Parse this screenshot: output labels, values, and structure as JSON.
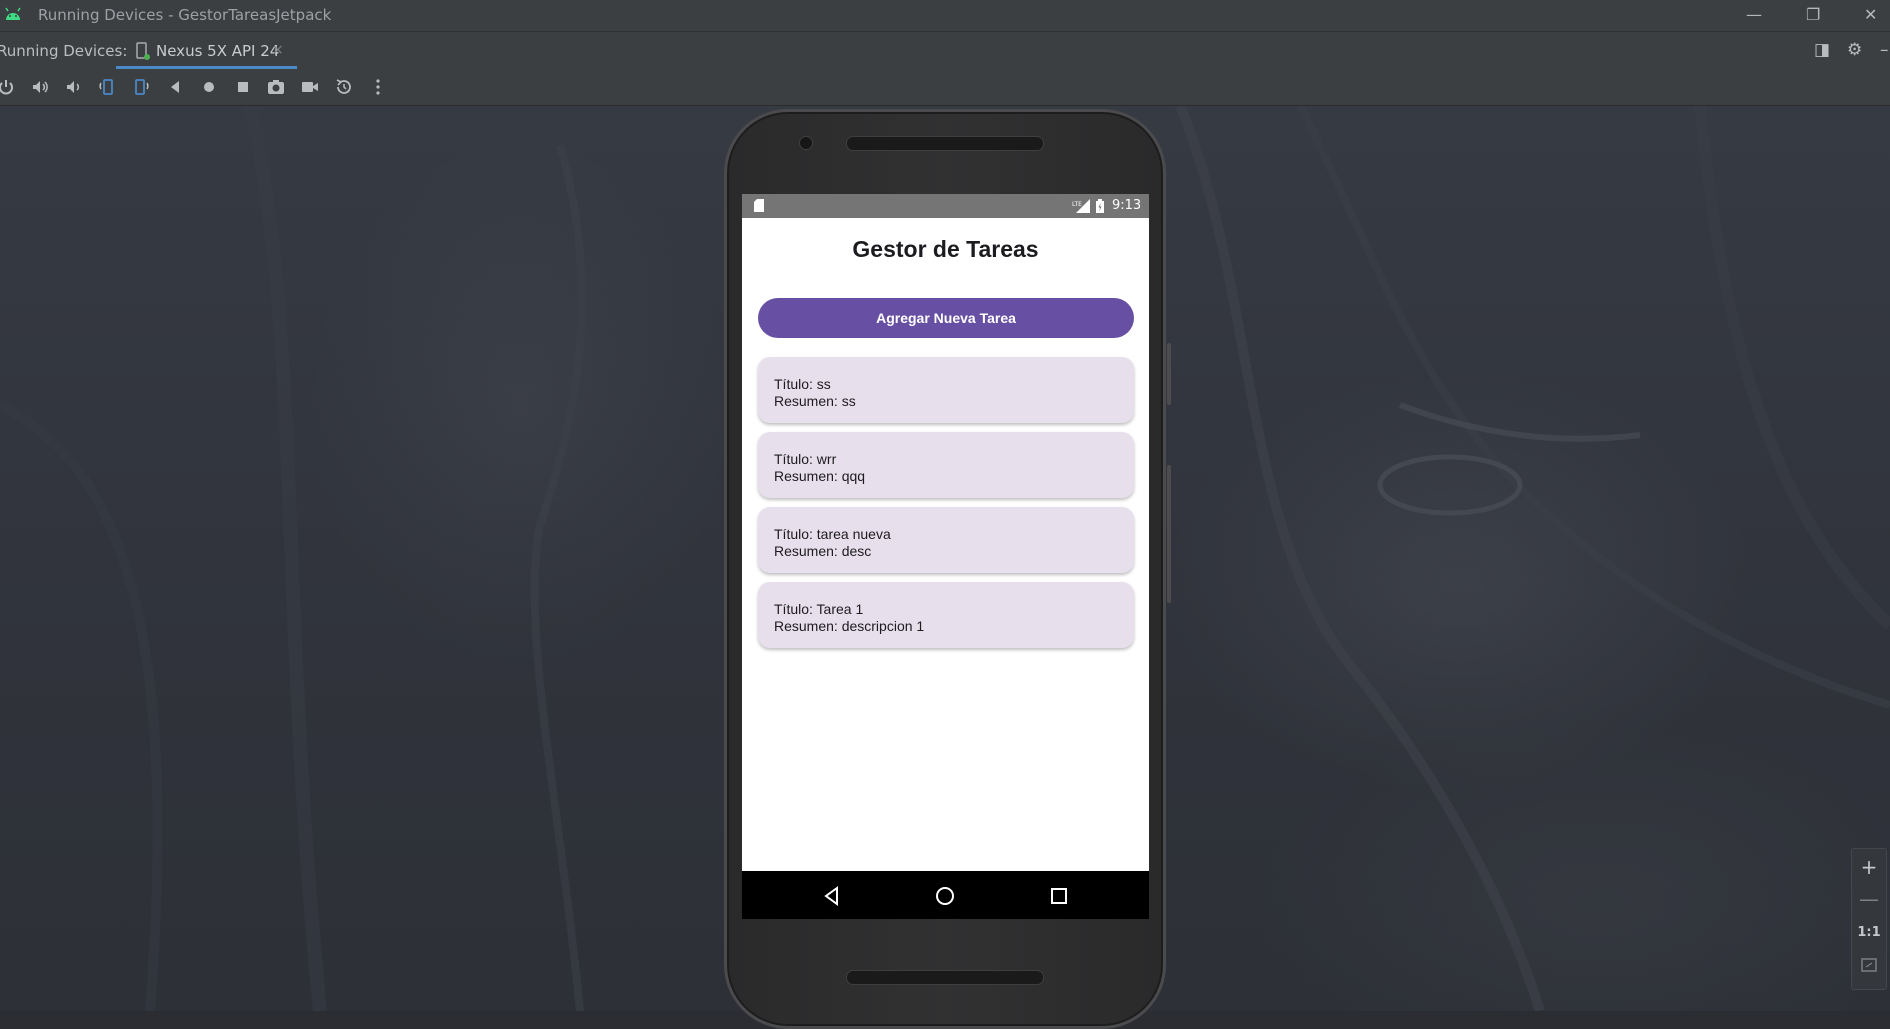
{
  "window": {
    "title": "Running Devices - GestorTareasJetpack",
    "controls": [
      "minimize",
      "restore",
      "close"
    ]
  },
  "tabs": {
    "label": "Running Devices:",
    "active_tab": "Nexus 5X API 24",
    "close_glyph": "×"
  },
  "toolbar": {
    "icons": [
      "power-icon",
      "volume-up-icon",
      "volume-down-icon",
      "rotate-left-icon",
      "rotate-right-icon",
      "back-icon",
      "home-icon",
      "overview-icon",
      "screenshot-icon",
      "screen-record-icon",
      "reset-icon",
      "more-icon"
    ]
  },
  "device": {
    "status_bar": {
      "time": "9:13",
      "network": "LTE"
    },
    "app": {
      "title": "Gestor de Tareas",
      "add_button": "Agregar Nueva Tarea",
      "tasks": [
        {
          "titulo": "Título: ss",
          "resumen": "Resumen: ss"
        },
        {
          "titulo": "Título: wrr",
          "resumen": "Resumen: qqq"
        },
        {
          "titulo": "Título: tarea nueva",
          "resumen": "Resumen: desc"
        },
        {
          "titulo": "Título: Tarea 1",
          "resumen": "Resumen: descripcion 1"
        }
      ]
    }
  },
  "zoom": {
    "zoom_in": "+",
    "zoom_out": "—",
    "actual_size": "1:1"
  },
  "colors": {
    "accent": "#6750a4",
    "card": "#e7e0ec",
    "ide_bg": "#3c3f41",
    "tab_underline": "#4a88c7"
  }
}
